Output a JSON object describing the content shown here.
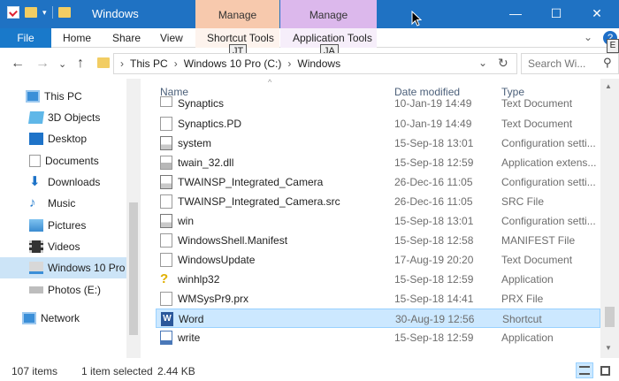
{
  "window": {
    "title": "Windows",
    "context_tabs": [
      "Manage",
      "Manage"
    ],
    "controls": {
      "minimize": "—",
      "maximize": "☐",
      "close": "✕"
    },
    "colors": {
      "titlebar": "#1f72c3",
      "manage1": "#f7c9ad",
      "manage2": "#dcb8ec"
    }
  },
  "ribbon": {
    "tabs": [
      "File",
      "Home",
      "Share",
      "View",
      "Shortcut Tools",
      "Application Tools"
    ],
    "keytips": {
      "shortcut": "JT",
      "application": "JA",
      "help": "E"
    },
    "help_icon": "?",
    "collapse_icon": "⌄"
  },
  "nav": {
    "back": "←",
    "forward": "→",
    "recent": "⌄",
    "up": "↑",
    "breadcrumb": [
      "This PC",
      "Windows 10 Pro (C:)",
      "Windows"
    ],
    "breadcrumb_sep": "›",
    "dropdown": "⌄",
    "refresh": "↻",
    "search_placeholder": "Search Wi...",
    "search_icon": "⚲"
  },
  "sidebar": {
    "items": [
      {
        "label": "This PC",
        "icon": "pc-icon"
      },
      {
        "label": "3D Objects",
        "icon": "cube-icon"
      },
      {
        "label": "Desktop",
        "icon": "desktop-icon"
      },
      {
        "label": "Documents",
        "icon": "documents-icon"
      },
      {
        "label": "Downloads",
        "icon": "downloads-icon"
      },
      {
        "label": "Music",
        "icon": "music-icon"
      },
      {
        "label": "Pictures",
        "icon": "pictures-icon"
      },
      {
        "label": "Videos",
        "icon": "videos-icon"
      },
      {
        "label": "Windows 10 Pro",
        "icon": "drive-icon",
        "selected": true
      },
      {
        "label": "Photos (E:)",
        "icon": "drive-icon"
      },
      {
        "label": "Network",
        "icon": "network-icon"
      }
    ]
  },
  "list": {
    "sort_indicator": "^",
    "columns": [
      "Name",
      "Date modified",
      "Type"
    ],
    "rows": [
      {
        "name": "Synaptics",
        "date": "10-Jan-19 14:49",
        "type": "Text Document",
        "icon": "text-file-icon"
      },
      {
        "name": "Synaptics.PD",
        "date": "10-Jan-19 14:49",
        "type": "Text Document",
        "icon": "text-file-icon"
      },
      {
        "name": "system",
        "date": "15-Sep-18 13:01",
        "type": "Configuration setti...",
        "icon": "config-file-icon"
      },
      {
        "name": "twain_32.dll",
        "date": "15-Sep-18 12:59",
        "type": "Application extens...",
        "icon": "dll-file-icon"
      },
      {
        "name": "TWAINSP_Integrated_Camera",
        "date": "26-Dec-16 11:05",
        "type": "Configuration setti...",
        "icon": "config-file-icon"
      },
      {
        "name": "TWAINSP_Integrated_Camera.src",
        "date": "26-Dec-16 11:05",
        "type": "SRC File",
        "icon": "blank-file-icon"
      },
      {
        "name": "win",
        "date": "15-Sep-18 13:01",
        "type": "Configuration setti...",
        "icon": "config-file-icon"
      },
      {
        "name": "WindowsShell.Manifest",
        "date": "15-Sep-18 12:58",
        "type": "MANIFEST File",
        "icon": "blank-file-icon"
      },
      {
        "name": "WindowsUpdate",
        "date": "17-Aug-19 20:20",
        "type": "Text Document",
        "icon": "text-file-icon"
      },
      {
        "name": "winhlp32",
        "date": "15-Sep-18 12:59",
        "type": "Application",
        "icon": "help-app-icon"
      },
      {
        "name": "WMSysPr9.prx",
        "date": "15-Sep-18 14:41",
        "type": "PRX File",
        "icon": "blank-file-icon"
      },
      {
        "name": "Word",
        "date": "30-Aug-19 12:56",
        "type": "Shortcut",
        "icon": "word-shortcut-icon",
        "selected": true
      },
      {
        "name": "write",
        "date": "15-Sep-18 12:59",
        "type": "Application",
        "icon": "write-app-icon"
      }
    ]
  },
  "status": {
    "item_count": "107 items",
    "selection": "1 item selected",
    "size": "2.44 KB"
  }
}
